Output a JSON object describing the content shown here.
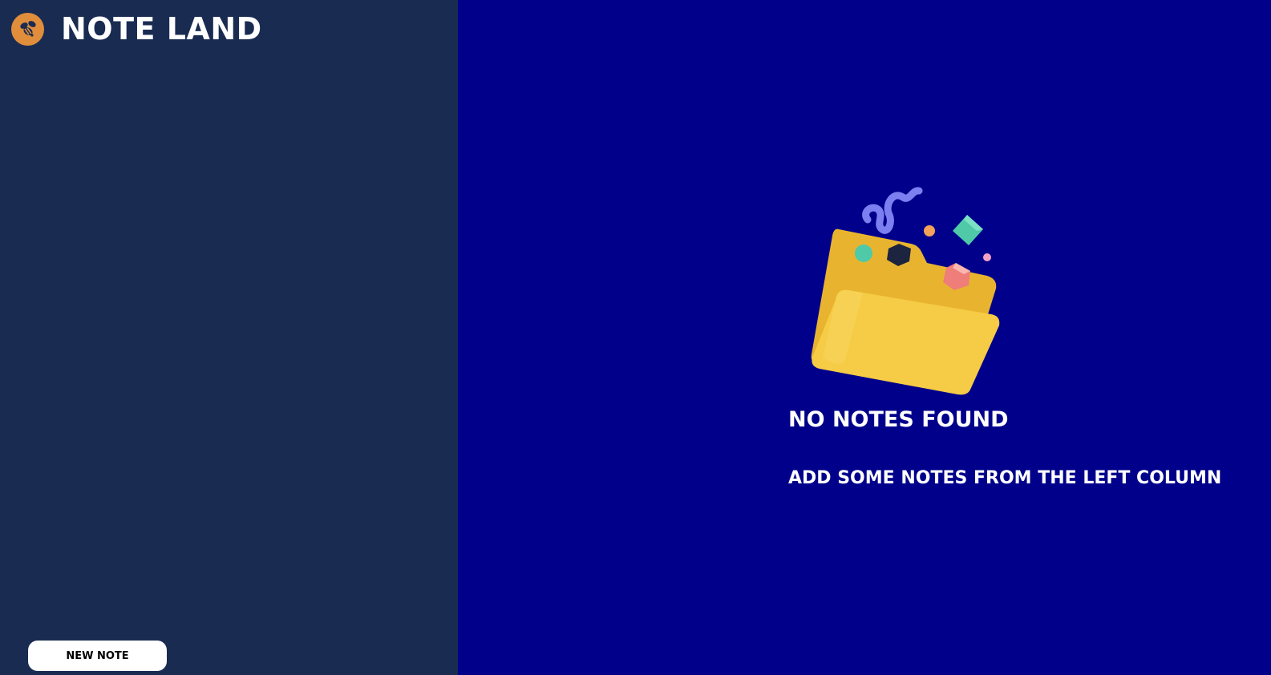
{
  "app": {
    "title": "NOTE LAND",
    "logo_icon": "bee-icon"
  },
  "sidebar": {
    "new_note_label": "NEW NOTE"
  },
  "main": {
    "empty_state": {
      "illustration_icon": "open-folder-icon",
      "title": "NO NOTES FOUND",
      "subtitle": "ADD SOME NOTES FROM THE LEFT COLUMN"
    }
  },
  "colors": {
    "sidebar_background": "#1a2b52",
    "main_background": "#00008b",
    "logo_background": "#e08e3b",
    "folder": "#f6cb45",
    "button_background": "#ffffff"
  }
}
